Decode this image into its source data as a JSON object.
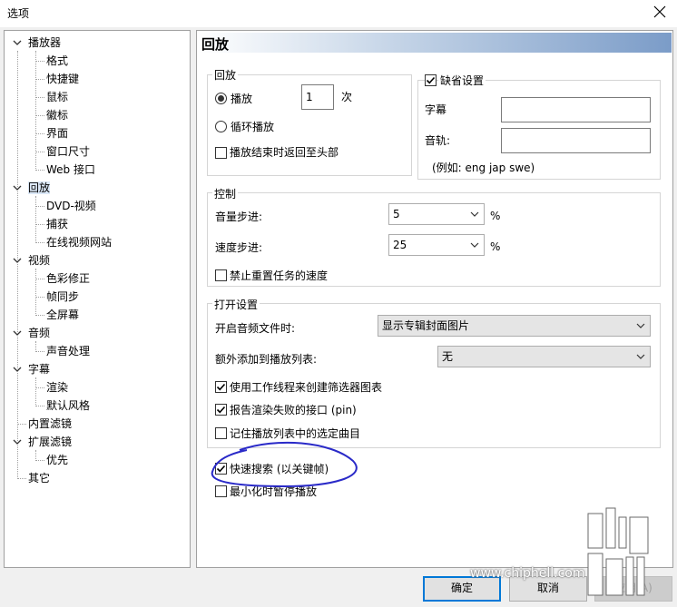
{
  "window": {
    "title": "选项"
  },
  "tree": {
    "items": [
      {
        "label": "播放器",
        "level": 0,
        "expanded": true
      },
      {
        "label": "格式",
        "level": 1
      },
      {
        "label": "快捷键",
        "level": 1
      },
      {
        "label": "鼠标",
        "level": 1
      },
      {
        "label": "徽标",
        "level": 1
      },
      {
        "label": "界面",
        "level": 1
      },
      {
        "label": "窗口尺寸",
        "level": 1
      },
      {
        "label": "Web 接口",
        "level": 1
      },
      {
        "label": "回放",
        "level": 0,
        "expanded": true,
        "selected": true
      },
      {
        "label": "DVD-视频",
        "level": 1
      },
      {
        "label": "捕获",
        "level": 1
      },
      {
        "label": "在线视频网站",
        "level": 1
      },
      {
        "label": "视频",
        "level": 0,
        "expanded": true
      },
      {
        "label": "色彩修正",
        "level": 1
      },
      {
        "label": "帧同步",
        "level": 1
      },
      {
        "label": "全屏幕",
        "level": 1
      },
      {
        "label": "音频",
        "level": 0,
        "expanded": true
      },
      {
        "label": "声音处理",
        "level": 1
      },
      {
        "label": "字幕",
        "level": 0,
        "expanded": true
      },
      {
        "label": "渲染",
        "level": 1
      },
      {
        "label": "默认风格",
        "level": 1
      },
      {
        "label": "内置滤镜",
        "level": 0
      },
      {
        "label": "扩展滤镜",
        "level": 0,
        "expanded": true
      },
      {
        "label": "优先",
        "level": 1
      },
      {
        "label": "其它",
        "level": 0
      }
    ]
  },
  "page": {
    "title": "回放",
    "playback_group": {
      "title": "回放",
      "play_label": "播放",
      "play_count": "1",
      "times_unit": "次",
      "loop_label": "循环播放",
      "rewind_label": "播放结束时返回至头部",
      "play_selected": true,
      "loop_selected": false,
      "rewind_checked": false
    },
    "default_group": {
      "title": "缺省设置",
      "checked": true,
      "subtitle_label": "字幕",
      "subtitle_value": "",
      "audio_label": "音轨:",
      "audio_value": "",
      "example_text": "(例如: eng jap swe)"
    },
    "control_group": {
      "title": "控制",
      "volume_step_label": "音量步进:",
      "volume_step_value": "5",
      "speed_step_label": "速度步进:",
      "speed_step_value": "25",
      "percent": "%",
      "disable_reset_label": "禁止重置任务的速度",
      "disable_reset_checked": false
    },
    "open_group": {
      "title": "打开设置",
      "audio_file_label": "开启音频文件时:",
      "audio_file_value": "显示专辑封面图片",
      "append_label": "额外添加到播放列表:",
      "append_value": "无",
      "worker_thread_label": "使用工作线程来创建筛选器图表",
      "worker_thread_checked": true,
      "report_fail_label": "报告渲染失败的接口 (pin)",
      "report_fail_checked": true,
      "remember_label": "记住播放列表中的选定曲目",
      "remember_checked": false
    },
    "fast_seek_label": "快速搜索 (以关键帧)",
    "fast_seek_checked": true,
    "pause_minimize_label": "最小化时暂停播放",
    "pause_minimize_checked": false
  },
  "buttons": {
    "ok": "确定",
    "cancel": "取消",
    "apply": "应用(A)"
  },
  "watermark": {
    "url": "www.chiphell.com"
  },
  "colors": {
    "annotation": "#2a2ac8",
    "default_button": "#0078d7",
    "selection": "#dbe8f7"
  }
}
